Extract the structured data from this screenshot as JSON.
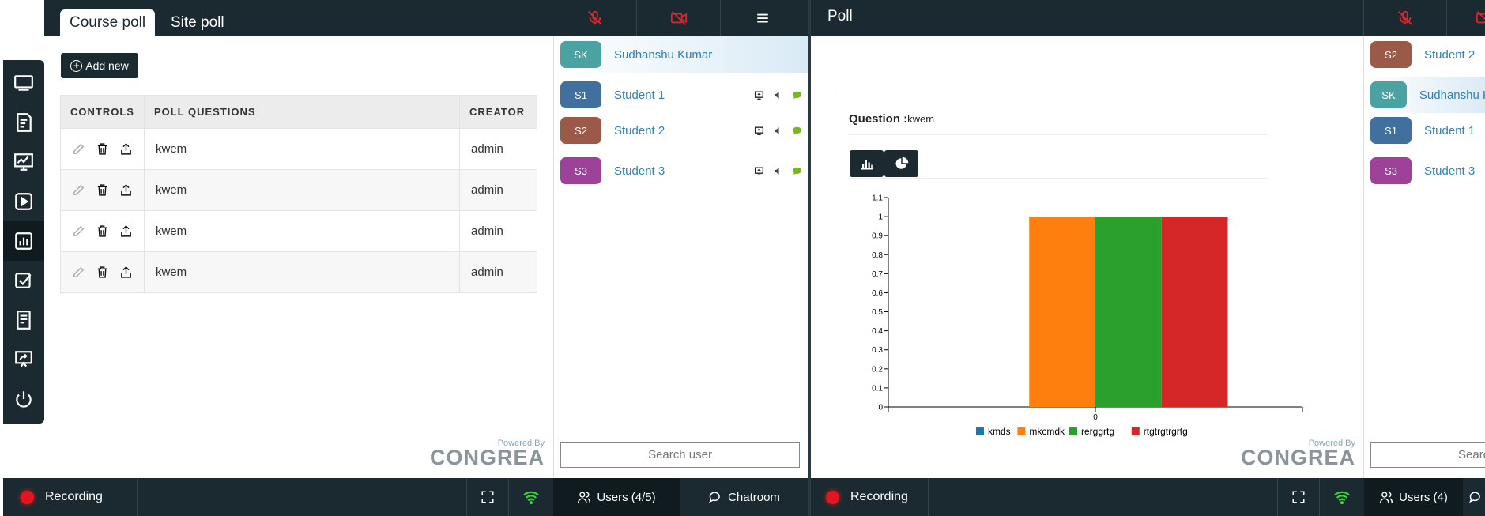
{
  "left": {
    "tabs": [
      {
        "label": "Course poll",
        "active": true
      },
      {
        "label": "Site poll",
        "active": false
      }
    ],
    "add_new_label": "Add new",
    "table": {
      "headers": [
        "CONTROLS",
        "POLL QUESTIONS",
        "CREATOR"
      ],
      "rows": [
        {
          "question": "kwem",
          "creator": "admin"
        },
        {
          "question": "kwem",
          "creator": "admin"
        },
        {
          "question": "kwem",
          "creator": "admin"
        },
        {
          "question": "kwem",
          "creator": "admin"
        }
      ]
    },
    "branding": {
      "powered_by": "Powered By",
      "name": "CONGREA"
    },
    "users": [
      {
        "initials": "SK",
        "name": "Sudhanshu Kumar",
        "color": "#4aa2a2",
        "highlight": true
      },
      {
        "initials": "S1",
        "name": "Student 1",
        "color": "#41709e"
      },
      {
        "initials": "S2",
        "name": "Student 2",
        "color": "#9b5a47"
      },
      {
        "initials": "S3",
        "name": "Student 3",
        "color": "#9d4199"
      }
    ],
    "search_placeholder": "Search user",
    "bottom": {
      "recording_label": "Recording",
      "users_tab_label": "Users (4/5)",
      "chatroom_label": "Chatroom"
    }
  },
  "right": {
    "title": "Poll",
    "question_label": "Question :",
    "question_value": "kwem",
    "users": [
      {
        "initials": "S2",
        "name": "Student 2",
        "color": "#9b5a47"
      },
      {
        "initials": "SK",
        "name": "Sudhanshu K",
        "color": "#4aa2a2"
      },
      {
        "initials": "S1",
        "name": "Student 1",
        "color": "#41709e"
      },
      {
        "initials": "S3",
        "name": "Student 3",
        "color": "#9d4199"
      }
    ],
    "search_placeholder": "Searc",
    "branding": {
      "powered_by": "Powered By",
      "name": "CONGREA"
    },
    "bottom": {
      "recording_label": "Recording",
      "users_tab_label": "Users (4)"
    }
  },
  "chart_data": {
    "type": "bar",
    "categories": [
      "0"
    ],
    "series": [
      {
        "name": "kmds",
        "values": [
          0
        ],
        "color": "#1f77b4"
      },
      {
        "name": "mkcmdk",
        "values": [
          1
        ],
        "color": "#ff7f0e"
      },
      {
        "name": "rerggrtg",
        "values": [
          1
        ],
        "color": "#2ca02c"
      },
      {
        "name": "rtgtrgtrgrtg",
        "values": [
          1
        ],
        "color": "#d62728"
      }
    ],
    "ylim": [
      0,
      1.1
    ],
    "yticks": [
      "0",
      "0.1",
      "0.2",
      "0.3",
      "0.4",
      "0.5",
      "0.6",
      "0.7",
      "0.8",
      "0.9",
      "1",
      "1.1"
    ],
    "xticks": [
      "0"
    ],
    "legend_position": "bottom",
    "grid": false
  }
}
